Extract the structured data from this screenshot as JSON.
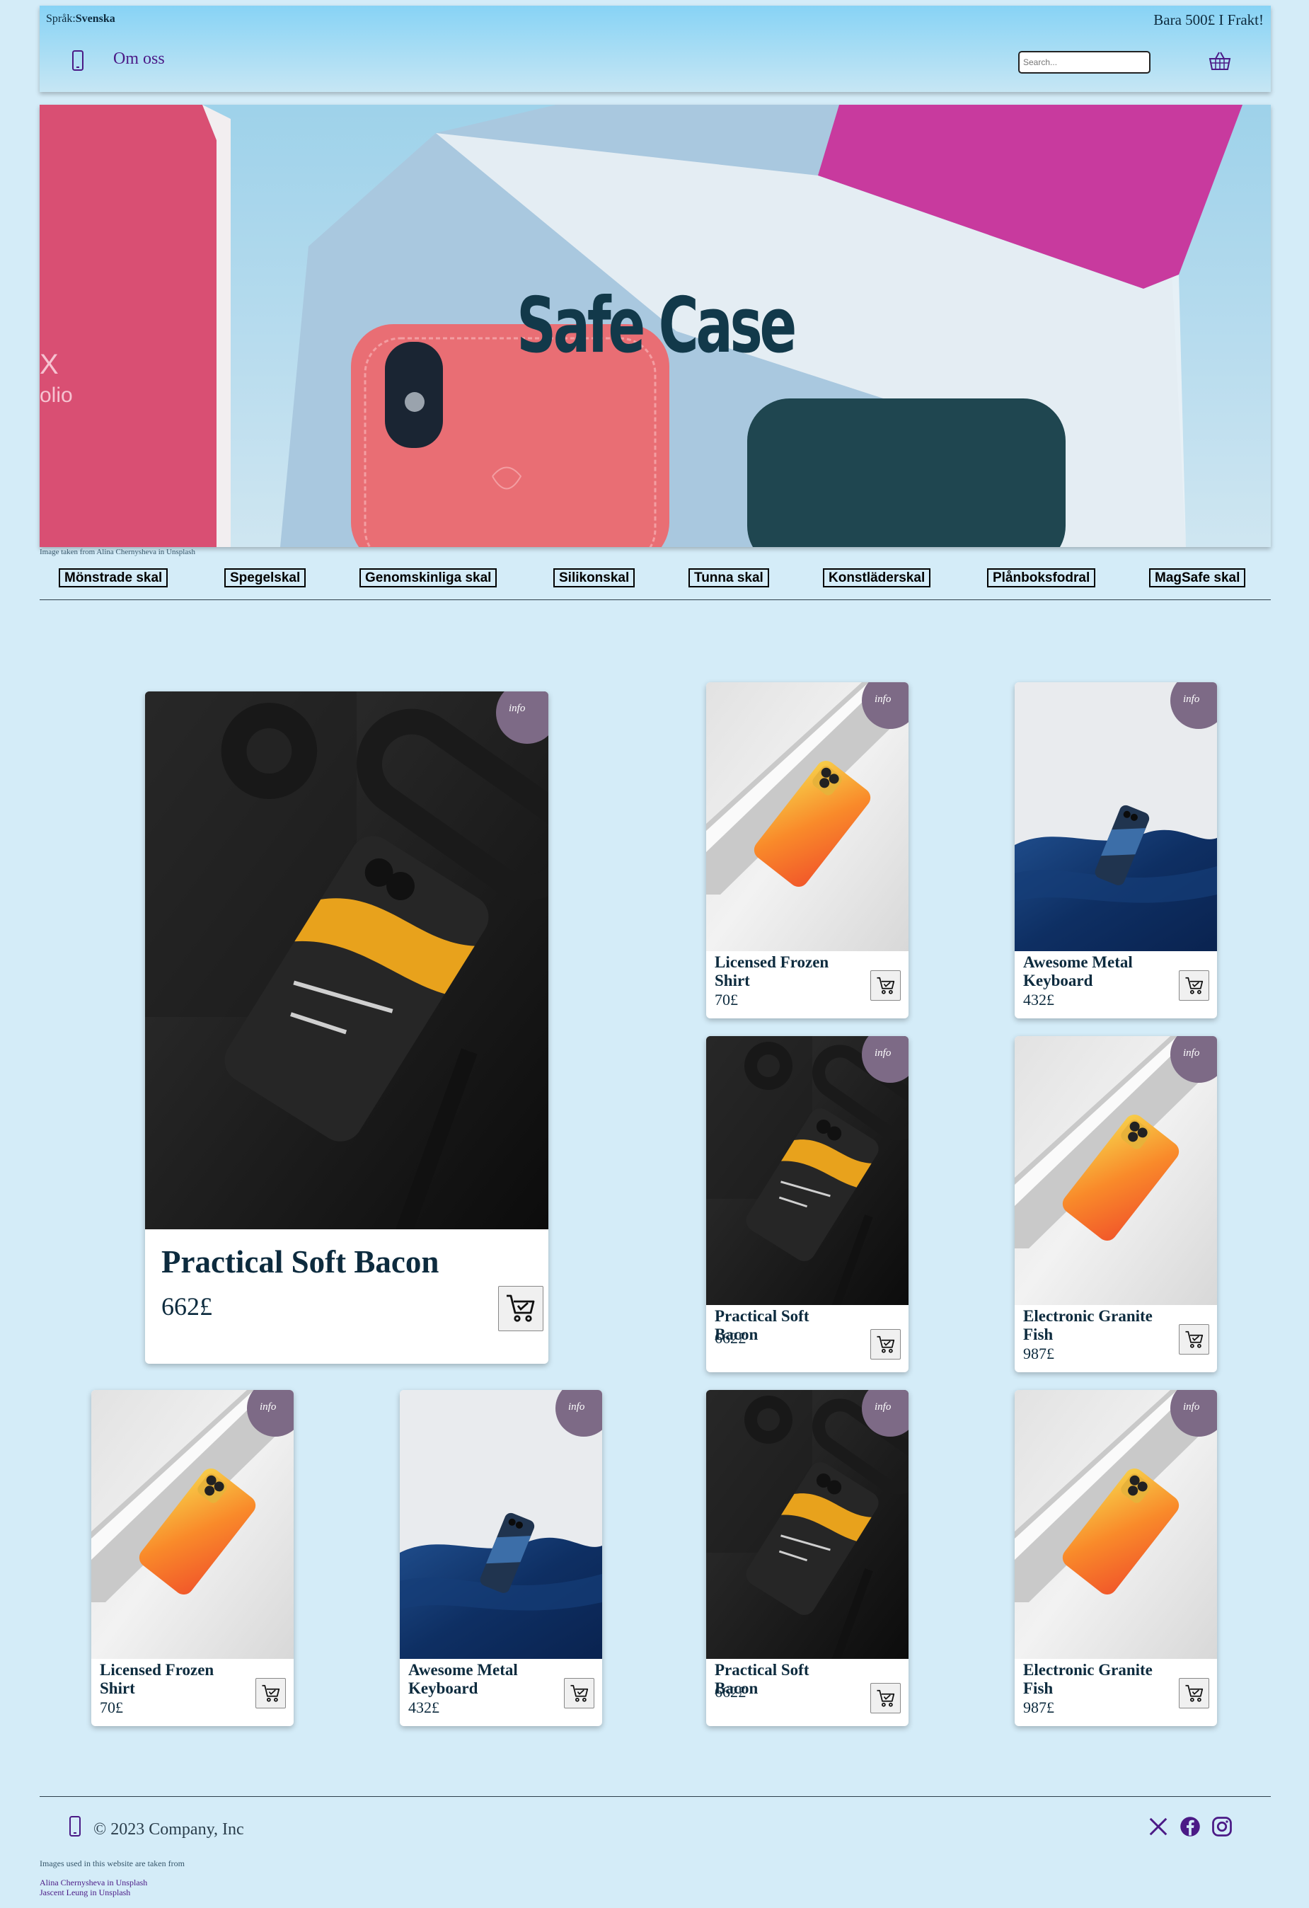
{
  "header": {
    "language_label": "Språk:",
    "language_value": "Svenska",
    "shipping_banner": "Bara 500£ I Frakt!",
    "about_link": "Om oss",
    "search_placeholder": "Search...",
    "accent_color": "#4b1a86"
  },
  "hero": {
    "title": "Safe Case",
    "credit": "Image taken from Alina Chernysheva in Unsplash"
  },
  "categories": [
    "Mönstrade skal",
    "Spegelskal",
    "Genomskinliga skal",
    "Silikonskal",
    "Tunna skal",
    "Konstläderskal",
    "Plånboksfodral",
    "MagSafe skal"
  ],
  "products": {
    "info_label": "info",
    "featured": {
      "name": "Practical Soft Bacon",
      "price": "662£",
      "image": "black-case"
    },
    "grid": [
      {
        "name": "Licensed Frozen Shirt",
        "price": "70£",
        "image": "orange-case"
      },
      {
        "name": "Awesome Metal Keyboard",
        "price": "432£",
        "image": "blue-case"
      },
      {
        "name": "Practical Soft Bacon",
        "price": "662£",
        "image": "black-case"
      },
      {
        "name": "Electronic Granite Fish",
        "price": "987£",
        "image": "orange-case"
      },
      {
        "name": "Licensed Frozen Shirt",
        "price": "70£",
        "image": "orange-case"
      },
      {
        "name": "Awesome Metal Keyboard",
        "price": "432£",
        "image": "blue-case"
      },
      {
        "name": "Practical Soft Bacon",
        "price": "662£",
        "image": "black-case"
      },
      {
        "name": "Electronic Granite Fish",
        "price": "987£",
        "image": "orange-case"
      }
    ]
  },
  "footer": {
    "copyright": "© 2023 Company, Inc",
    "images_note": "Images used in this website are taken from",
    "credits": [
      "Alina Chernysheva in Unsplash",
      "Jascent Leung in Unsplash"
    ],
    "social": [
      "x-icon",
      "facebook-icon",
      "instagram-icon"
    ]
  }
}
